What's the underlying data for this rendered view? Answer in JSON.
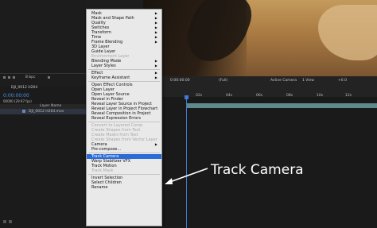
{
  "project_panel": {
    "layer_label": "8 bpc"
  },
  "timeline": {
    "timecode": "0:00:00:00",
    "frames": "00000 (29.97 fps)",
    "col_layer_name": "Layer Name",
    "layer_row": "DJI_0012 H264.mov",
    "comp_tab": "DJI_0012 H264",
    "ruler": [
      "02s",
      "04s",
      "06s",
      "08s",
      "10s",
      "12s",
      "14s"
    ]
  },
  "viewer_bar": {
    "timecode": "0:00:00:00",
    "resolution": "(Full)",
    "camera": "Active Camera",
    "view": "1 View",
    "offset": "+0.0"
  },
  "menu": {
    "items": [
      {
        "label": "Mask",
        "sub": true
      },
      {
        "label": "Mask and Shape Path",
        "sub": true
      },
      {
        "label": "Quality",
        "sub": true
      },
      {
        "label": "Switches",
        "sub": true
      },
      {
        "label": "Transform",
        "sub": true
      },
      {
        "label": "Time",
        "sub": true
      },
      {
        "label": "Frame Blending",
        "sub": true
      },
      {
        "label": "3D Layer"
      },
      {
        "label": "Guide Layer"
      },
      {
        "label": "Environment Layer",
        "disabled": true
      },
      {
        "label": "Blending Mode",
        "sub": true
      },
      {
        "label": "Layer Styles",
        "sub": true
      },
      {
        "sep": true
      },
      {
        "label": "Effect",
        "sub": true
      },
      {
        "label": "Keyframe Assistant",
        "sub": true
      },
      {
        "sep": true
      },
      {
        "label": "Open Effect Controls"
      },
      {
        "label": "Open Layer"
      },
      {
        "label": "Open Layer Source"
      },
      {
        "label": "Reveal in Finder"
      },
      {
        "label": "Reveal Layer Source in Project"
      },
      {
        "label": "Reveal Layer in Project Flowchart"
      },
      {
        "label": "Reveal Composition in Project"
      },
      {
        "label": "Reveal Expression Errors"
      },
      {
        "sep": true
      },
      {
        "label": "Convert to Layered Comp",
        "disabled": true
      },
      {
        "label": "Create Shapes from Text",
        "disabled": true
      },
      {
        "label": "Create Masks from Text",
        "disabled": true
      },
      {
        "label": "Create Shapes from Vector Layer",
        "disabled": true
      },
      {
        "label": "Camera",
        "sub": true
      },
      {
        "label": "Pre-compose..."
      },
      {
        "sep": true
      },
      {
        "label": "Track Camera",
        "highlight": true
      },
      {
        "label": "Warp Stabilizer VFX"
      },
      {
        "label": "Track Motion"
      },
      {
        "label": "Track Mask",
        "disabled": true
      },
      {
        "sep": true
      },
      {
        "label": "Invert Selection"
      },
      {
        "label": "Select Children"
      },
      {
        "label": "Rename"
      }
    ]
  },
  "annotation": {
    "text": "Track Camera"
  }
}
